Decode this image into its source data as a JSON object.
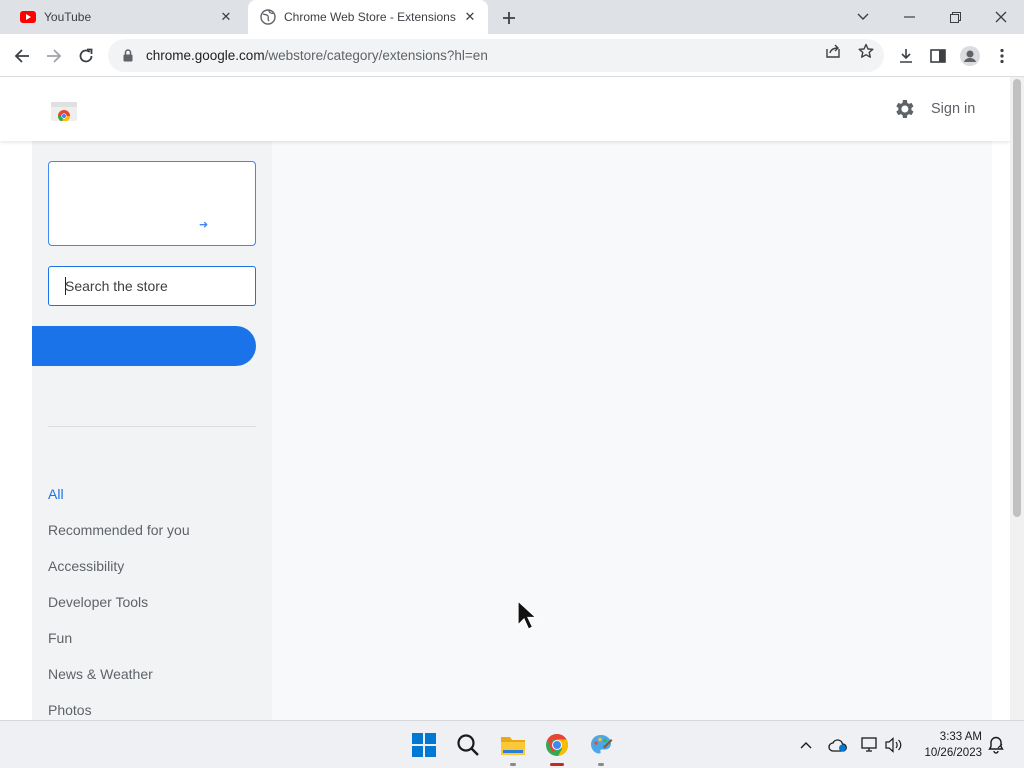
{
  "browser": {
    "tabs": [
      {
        "title": "YouTube",
        "icon": "youtube-icon",
        "active": false
      },
      {
        "title": "Chrome Web Store - Extensions",
        "icon": "globe-icon",
        "active": true
      }
    ],
    "url": {
      "host": "chrome.google.com",
      "path": "/webstore/category/extensions?hl=en"
    }
  },
  "header": {
    "sign_in": "Sign in"
  },
  "sidebar": {
    "search_placeholder": "Search the store",
    "categories": [
      {
        "label": "All",
        "active": true
      },
      {
        "label": "Recommended for you"
      },
      {
        "label": "Accessibility"
      },
      {
        "label": "Developer Tools"
      },
      {
        "label": "Fun"
      },
      {
        "label": "News & Weather"
      },
      {
        "label": "Photos"
      }
    ]
  },
  "taskbar": {
    "time": "3:33 AM",
    "date": "10/26/2023"
  },
  "colors": {
    "accent": "#1a73e8",
    "youtube_red": "#ff0000",
    "sidebar_bg": "#f1f3f4"
  }
}
